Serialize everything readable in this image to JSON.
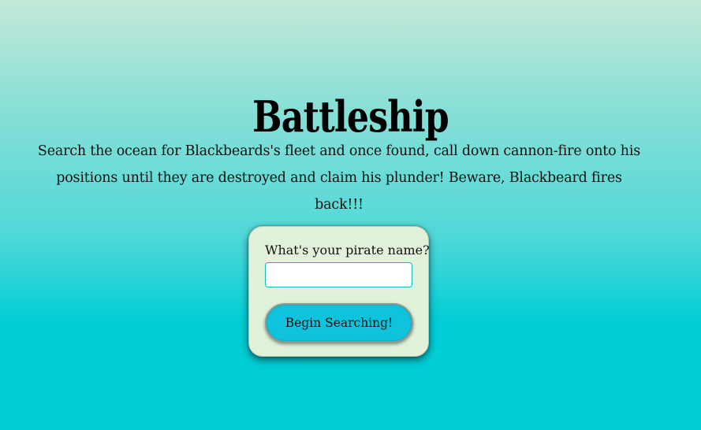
{
  "page": {
    "title": "Battleship",
    "intro": "Search the ocean for Blackbeards's fleet and once found, call down cannon-fire onto his positions until they are destroyed and claim his plunder! Beware, Blackbeard fires back!!!"
  },
  "form": {
    "name_label": "What's your pirate name?",
    "name_value": "",
    "name_placeholder": "",
    "submit_label": "Begin Searching!"
  },
  "colors": {
    "background_top": "#c4e9d8",
    "background_bottom": "#00cdd6",
    "card_background": "#e2f1da",
    "button_background": "#10c3dd",
    "input_border": "#19b7c4"
  }
}
